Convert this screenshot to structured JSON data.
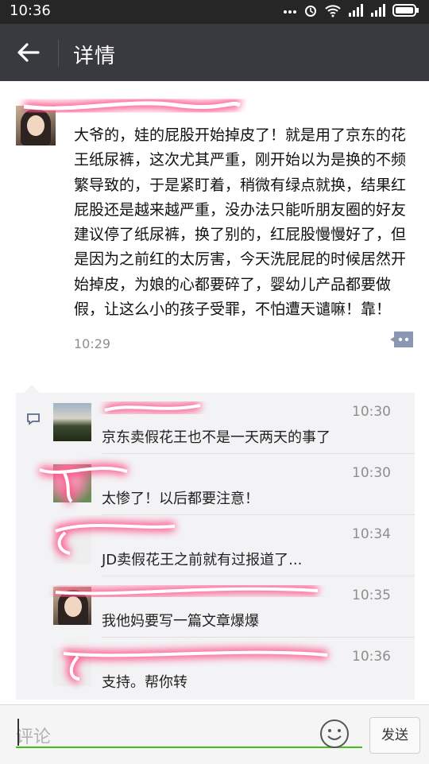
{
  "status_bar": {
    "time": "10:36",
    "icons": [
      "more-dots-icon",
      "alarm-icon",
      "wifi-icon",
      "signal-icon",
      "signal-icon",
      "battery-icon"
    ]
  },
  "app_bar": {
    "title": "详情",
    "back_icon": "arrow-left-icon"
  },
  "post": {
    "text": "大爷的，娃的屁股开始掉皮了！就是用了京东的花王纸尿裤，这次尤其严重，刚开始以为是换的不频繁导致的，于是紧盯着，稍微有绿点就换，结果红屁股还是越来越严重，没办法只能听朋友圈的好友建议停了纸尿裤，换了别的，红屁股慢慢好了，但是因为之前红的太厉害，今天洗屁屁的时候居然开始掉皮，为娘的心都要碎了，婴幼儿产品都要做假，让这么小的孩子受罪，不怕遭天谴嘛！靠！",
    "time": "10:29"
  },
  "comments": [
    {
      "time": "10:30",
      "text": "京东卖假花王也不是一天两天的事了"
    },
    {
      "time": "10:30",
      "text": "太惨了！以后都要注意！"
    },
    {
      "time": "10:34",
      "text": "JD卖假花王之前就有过报道了..."
    },
    {
      "time": "10:35",
      "text": "我他妈要写一篇文章爆爆"
    },
    {
      "time": "10:36",
      "text": "支持。帮你转"
    }
  ],
  "input_bar": {
    "placeholder": "评论",
    "send_label": "发送"
  },
  "colors": {
    "app_bar": "#393a3f",
    "status_bar": "#262626",
    "input_underline": "#45c01a",
    "comment_panel": "#f3f3f5",
    "redaction": "#ff4f86"
  }
}
